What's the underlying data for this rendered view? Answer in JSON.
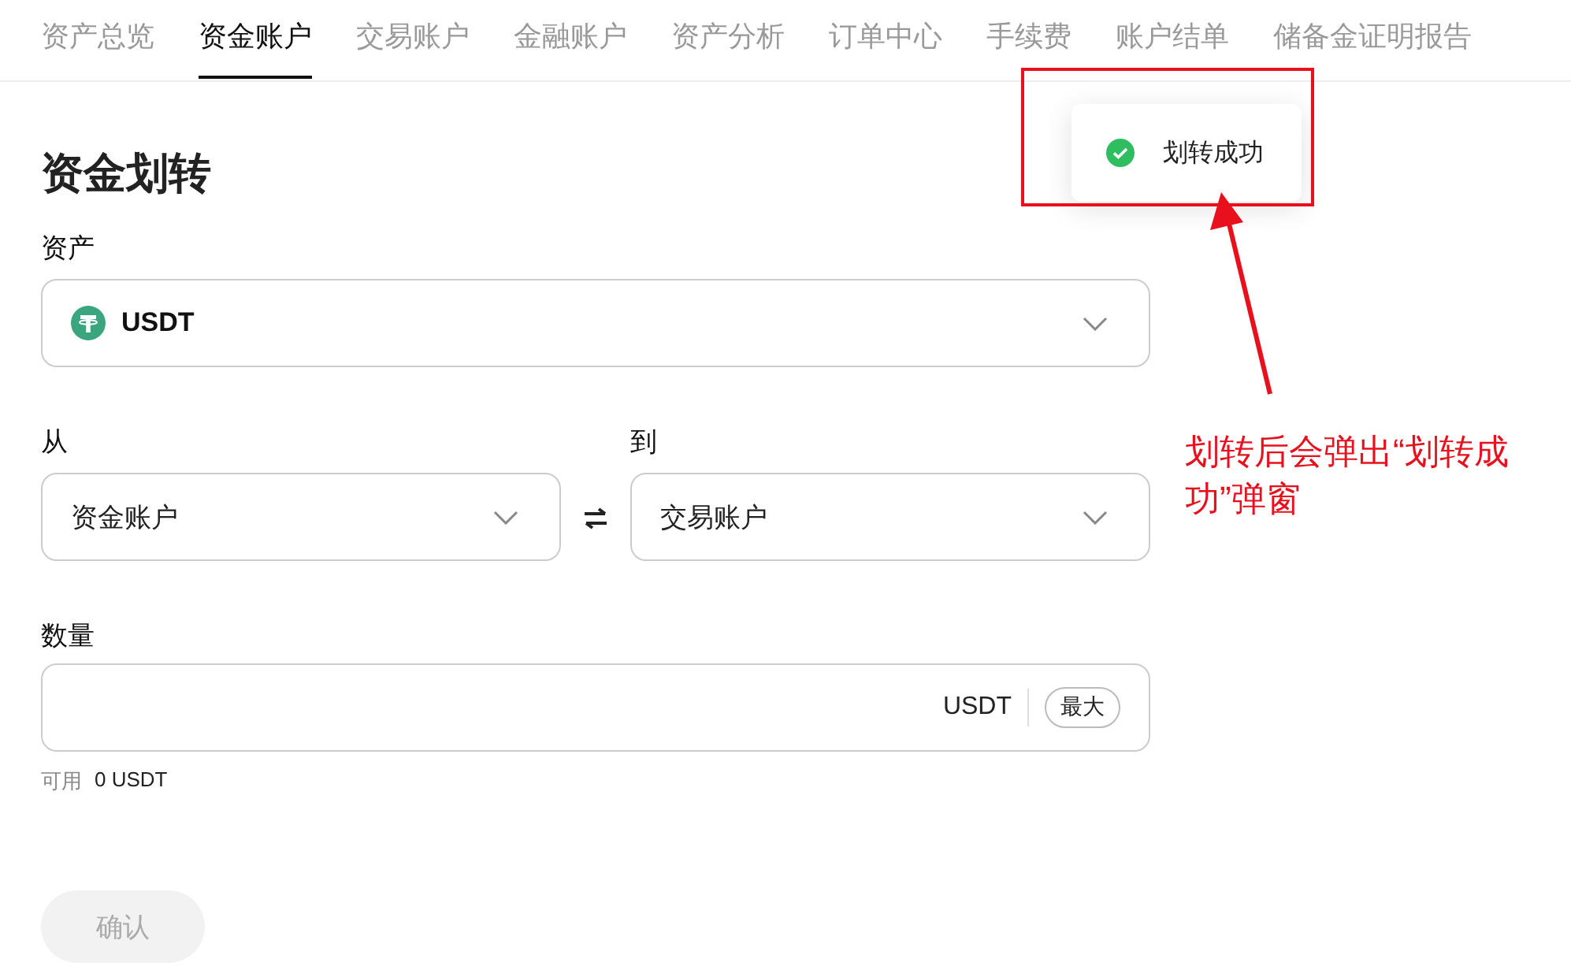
{
  "tabs": [
    {
      "label": "资产总览",
      "selected": false
    },
    {
      "label": "资金账户",
      "selected": true
    },
    {
      "label": "交易账户",
      "selected": false
    },
    {
      "label": "金融账户",
      "selected": false
    },
    {
      "label": "资产分析",
      "selected": false
    },
    {
      "label": "订单中心",
      "selected": false
    },
    {
      "label": "手续费",
      "selected": false
    },
    {
      "label": "账户结单",
      "selected": false
    },
    {
      "label": "储备金证明报告",
      "selected": false
    }
  ],
  "form": {
    "title": "资金划转",
    "asset": {
      "label": "资产",
      "value": "USDT"
    },
    "from": {
      "label": "从",
      "value": "资金账户"
    },
    "to": {
      "label": "到",
      "value": "交易账户"
    },
    "amount": {
      "label": "数量",
      "unit": "USDT",
      "max_button": "最大"
    },
    "available": {
      "label": "可用",
      "value": "0 USDT"
    },
    "confirm": {
      "label": "确认",
      "disabled": true
    }
  },
  "toast": {
    "message": "划转成功"
  },
  "annotation": {
    "text": "划转后会弹出“划转成功”弹窗"
  }
}
